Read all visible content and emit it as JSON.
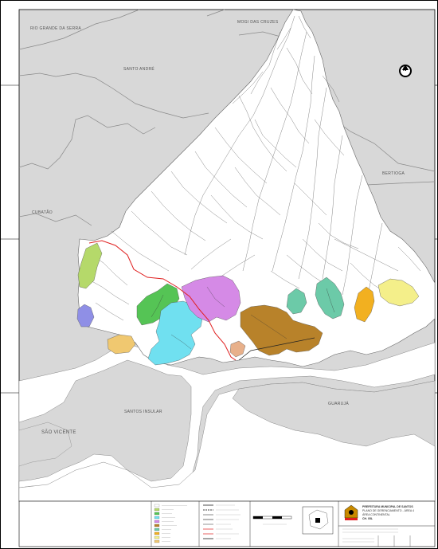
{
  "map": {
    "place_labels": {
      "rio_grande_da_serra": "RIO GRANDE DA SERRA",
      "mogi_das_cruzes": "MOGI DAS CRUZES",
      "santo_andre": "SANTO ANDRÉ",
      "cubatao": "CUBATÃO",
      "bertioga": "BERTIOGA",
      "santos_insular": "SANTOS INSULAR",
      "sao_vicente": "SÃO VICENTE",
      "guaruja": "GUARUJÁ"
    },
    "north_arrow_letter": "N",
    "colors": {
      "background_land": "#d8d8d8",
      "santos_continental": "#ffffff",
      "water": "#ffffff",
      "road": "#e02020",
      "zone_lightgreen": "#b5d96a",
      "zone_blue": "#8f8fe6",
      "zone_tan": "#f0c870",
      "zone_green": "#55c455",
      "zone_cyan": "#70e0f0",
      "zone_purple": "#d58ae6",
      "zone_salmon": "#e8b08a",
      "zone_brown": "#b8822a",
      "zone_teal": "#6ccaa8",
      "zone_orange": "#f2b020",
      "zone_yellow": "#f4ef8a"
    }
  },
  "legend": {
    "title_block": {
      "line1": "PREFEITURA MUNICIPAL DE SANTOS",
      "line2": "PLANO DE GERENCIAMENTO - ÁREA 4",
      "line3": "ÁREA CONTINENTAL",
      "line4": "CH. 05L"
    }
  }
}
